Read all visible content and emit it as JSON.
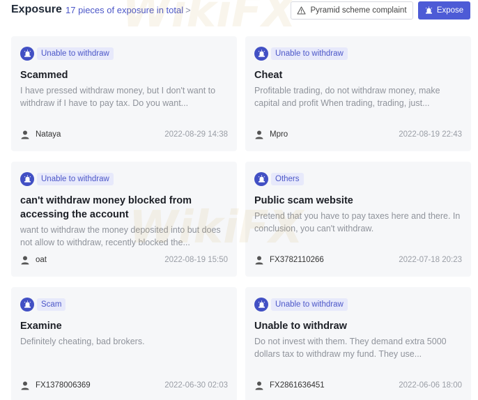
{
  "header": {
    "title": "Exposure",
    "count_text": "17 pieces of exposure in total",
    "chevron": ">",
    "complaint_label": "Pyramid scheme complaint",
    "expose_label": "Expose"
  },
  "watermark_text": "WikiFX",
  "cards": [
    {
      "tag": "Unable to withdraw",
      "title": "Scammed",
      "body": "I have pressed withdraw money, but I don't want to withdraw if I have to pay tax. Do you want...",
      "user": "Nataya",
      "date": "2022-08-29 14:38"
    },
    {
      "tag": "Unable to withdraw",
      "title": "Cheat",
      "body": "Profitable trading, do not withdraw money, make capital and profit When trading, trading, just...",
      "user": "Mpro",
      "date": "2022-08-19 22:43"
    },
    {
      "tag": "Unable to withdraw",
      "title": "can't withdraw money blocked from accessing the account",
      "body": "want to withdraw the money deposited into but does not allow to withdraw, recently blocked the...",
      "user": "oat",
      "date": "2022-08-19 15:50"
    },
    {
      "tag": "Others",
      "title": "Public scam website",
      "body": "Pretend that you have to pay taxes here and there. In conclusion, you can't withdraw.",
      "user": "FX3782110266",
      "date": "2022-07-18 20:23"
    },
    {
      "tag": "Scam",
      "title": "Examine",
      "body": "Definitely cheating, bad brokers.",
      "user": "FX1378006369",
      "date": "2022-06-30 02:03"
    },
    {
      "tag": "Unable to withdraw",
      "title": "Unable to withdraw",
      "body": "Do not invest with them. They demand extra 5000 dollars tax to withdraw my fund. They use...",
      "user": "FX2861636451",
      "date": "2022-06-06 18:00"
    }
  ]
}
